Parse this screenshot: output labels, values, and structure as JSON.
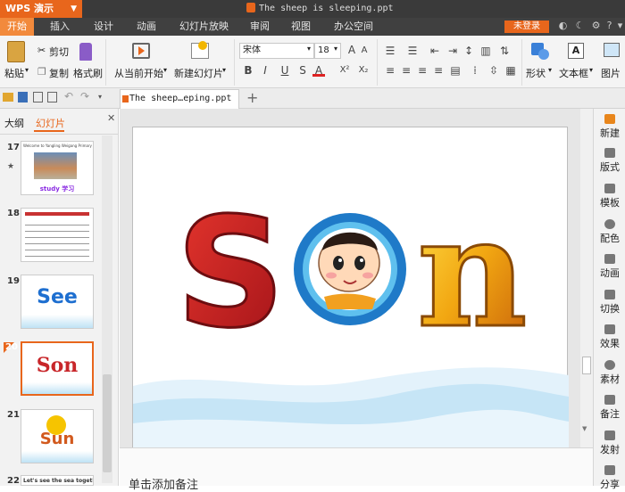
{
  "app": {
    "logo": "WPS 演示",
    "doc_title": "The sheep is sleeping.ppt"
  },
  "menu": [
    "开始",
    "插入",
    "设计",
    "动画",
    "幻灯片放映",
    "审阅",
    "视图",
    "办公空间"
  ],
  "login_label": "未登录",
  "ribbon": {
    "paste": "粘贴",
    "cut": "剪切",
    "copy": "复制",
    "format_painter": "格式刷",
    "from_current": "从当前开始",
    "new_slide": "新建幻灯片",
    "font_name": "宋体",
    "font_size": "18",
    "shape": "形状",
    "textbox": "文本框",
    "picture": "图片"
  },
  "doc_tab": "The sheep…eping.ppt",
  "left_panel": {
    "tab_outline": "大纲",
    "tab_slides": "幻灯片",
    "slides": [
      {
        "num": "17",
        "caption": "study 学习",
        "header": "Welcome to Yangling Weigang Primary School"
      },
      {
        "num": "18"
      },
      {
        "num": "19",
        "word": "See"
      },
      {
        "num": "20",
        "word": "Son"
      },
      {
        "num": "21",
        "word": "Sun"
      },
      {
        "num": "22",
        "text": "Let's see the sea together"
      }
    ]
  },
  "slide": {
    "word_s": "S",
    "word_n": "n"
  },
  "notes_placeholder": "单击添加备注",
  "right_panel": [
    "新建",
    "版式",
    "模板",
    "配色",
    "动画",
    "切换",
    "效果",
    "素材",
    "备注",
    "发射",
    "分享"
  ],
  "colors": {
    "accent": "#e8661c",
    "titlebar": "#3a3a3a",
    "menubar": "#404040"
  }
}
